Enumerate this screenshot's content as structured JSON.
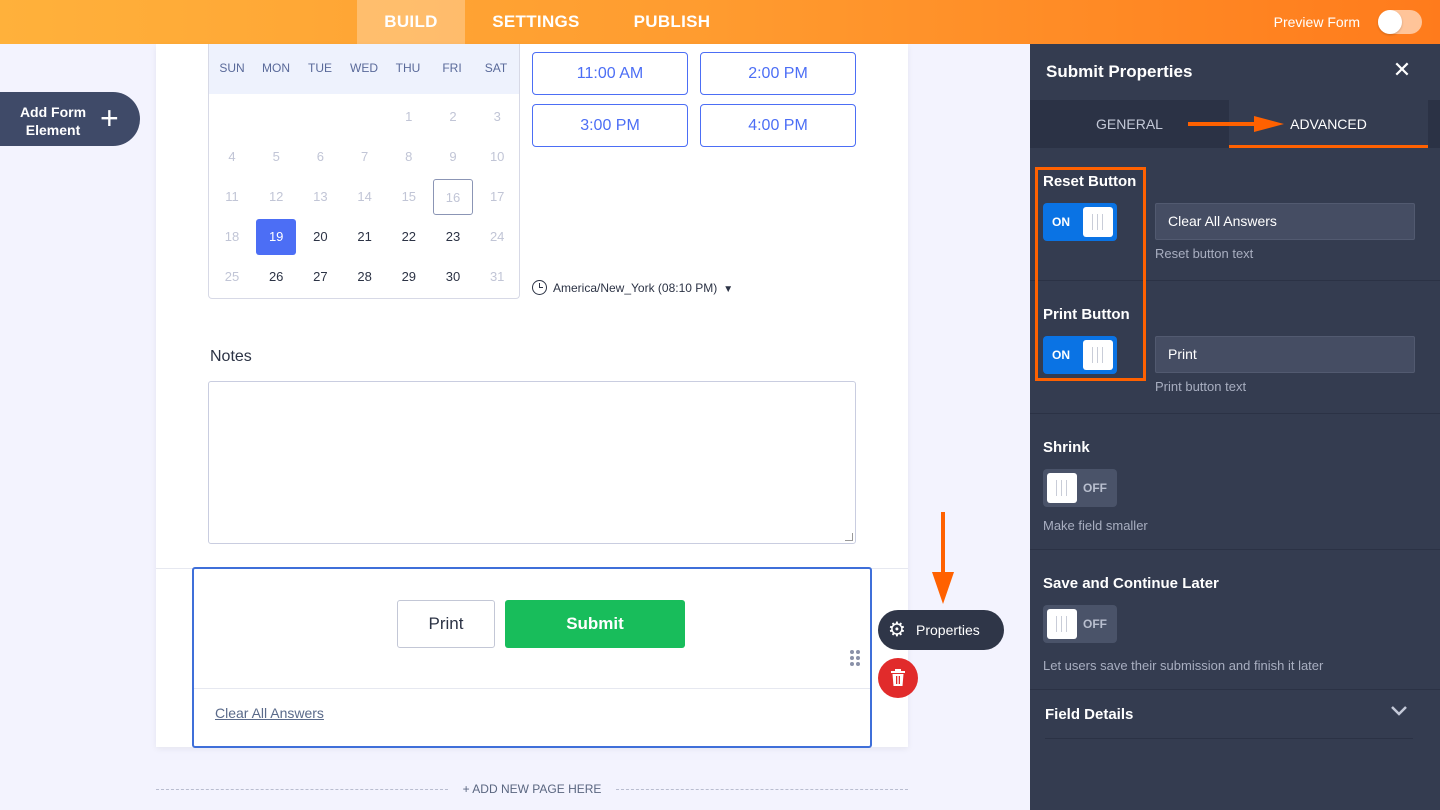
{
  "topbar": {
    "tabs": [
      "BUILD",
      "SETTINGS",
      "PUBLISH"
    ],
    "preview_label": "Preview Form"
  },
  "add_element": {
    "label": "Add Form Element",
    "icon": "plus-icon"
  },
  "calendar": {
    "weekdays": [
      "SUN",
      "MON",
      "TUE",
      "WED",
      "THU",
      "FRI",
      "SAT"
    ],
    "weeks": [
      [
        "",
        "",
        "",
        "",
        "1",
        "2",
        "3"
      ],
      [
        "4",
        "5",
        "6",
        "7",
        "8",
        "9",
        "10"
      ],
      [
        "11",
        "12",
        "13",
        "14",
        "15",
        "16",
        "17"
      ],
      [
        "18",
        "19",
        "20",
        "21",
        "22",
        "23",
        "24"
      ],
      [
        "25",
        "26",
        "27",
        "28",
        "29",
        "30",
        "31"
      ]
    ],
    "selected_day": "19",
    "today": "16",
    "enabled_days": [
      "19",
      "20",
      "21",
      "22",
      "23",
      "26",
      "27",
      "28",
      "29",
      "30"
    ]
  },
  "time_slots": [
    "11:00 AM",
    "2:00 PM",
    "3:00 PM",
    "4:00 PM"
  ],
  "timezone": "America/New_York (08:10 PM)",
  "notes": {
    "label": "Notes",
    "value": ""
  },
  "submit_area": {
    "print_label": "Print",
    "submit_label": "Submit",
    "clear_link": "Clear All Answers",
    "properties_label": "Properties"
  },
  "add_page_label": "+ ADD NEW PAGE HERE",
  "panel": {
    "title": "Submit Properties",
    "tabs": [
      "GENERAL",
      "ADVANCED"
    ],
    "active_tab": "ADVANCED",
    "reset": {
      "label": "Reset Button",
      "toggle": "ON",
      "value": "Clear All Answers",
      "desc": "Reset button text"
    },
    "print": {
      "label": "Print Button",
      "toggle": "ON",
      "value": "Print",
      "desc": "Print button text"
    },
    "shrink": {
      "label": "Shrink",
      "toggle": "OFF",
      "desc": "Make field smaller"
    },
    "save_continue": {
      "label": "Save and Continue Later",
      "toggle": "OFF",
      "desc": "Let users save their submission and finish it later"
    },
    "field_details": "Field Details"
  },
  "colors": {
    "accent": "#ff6100",
    "brand_gradient_start": "#ffb13b",
    "submit_green": "#18bd5b",
    "toggle_blue": "#0a73e4",
    "panel_bg": "#343c50"
  }
}
